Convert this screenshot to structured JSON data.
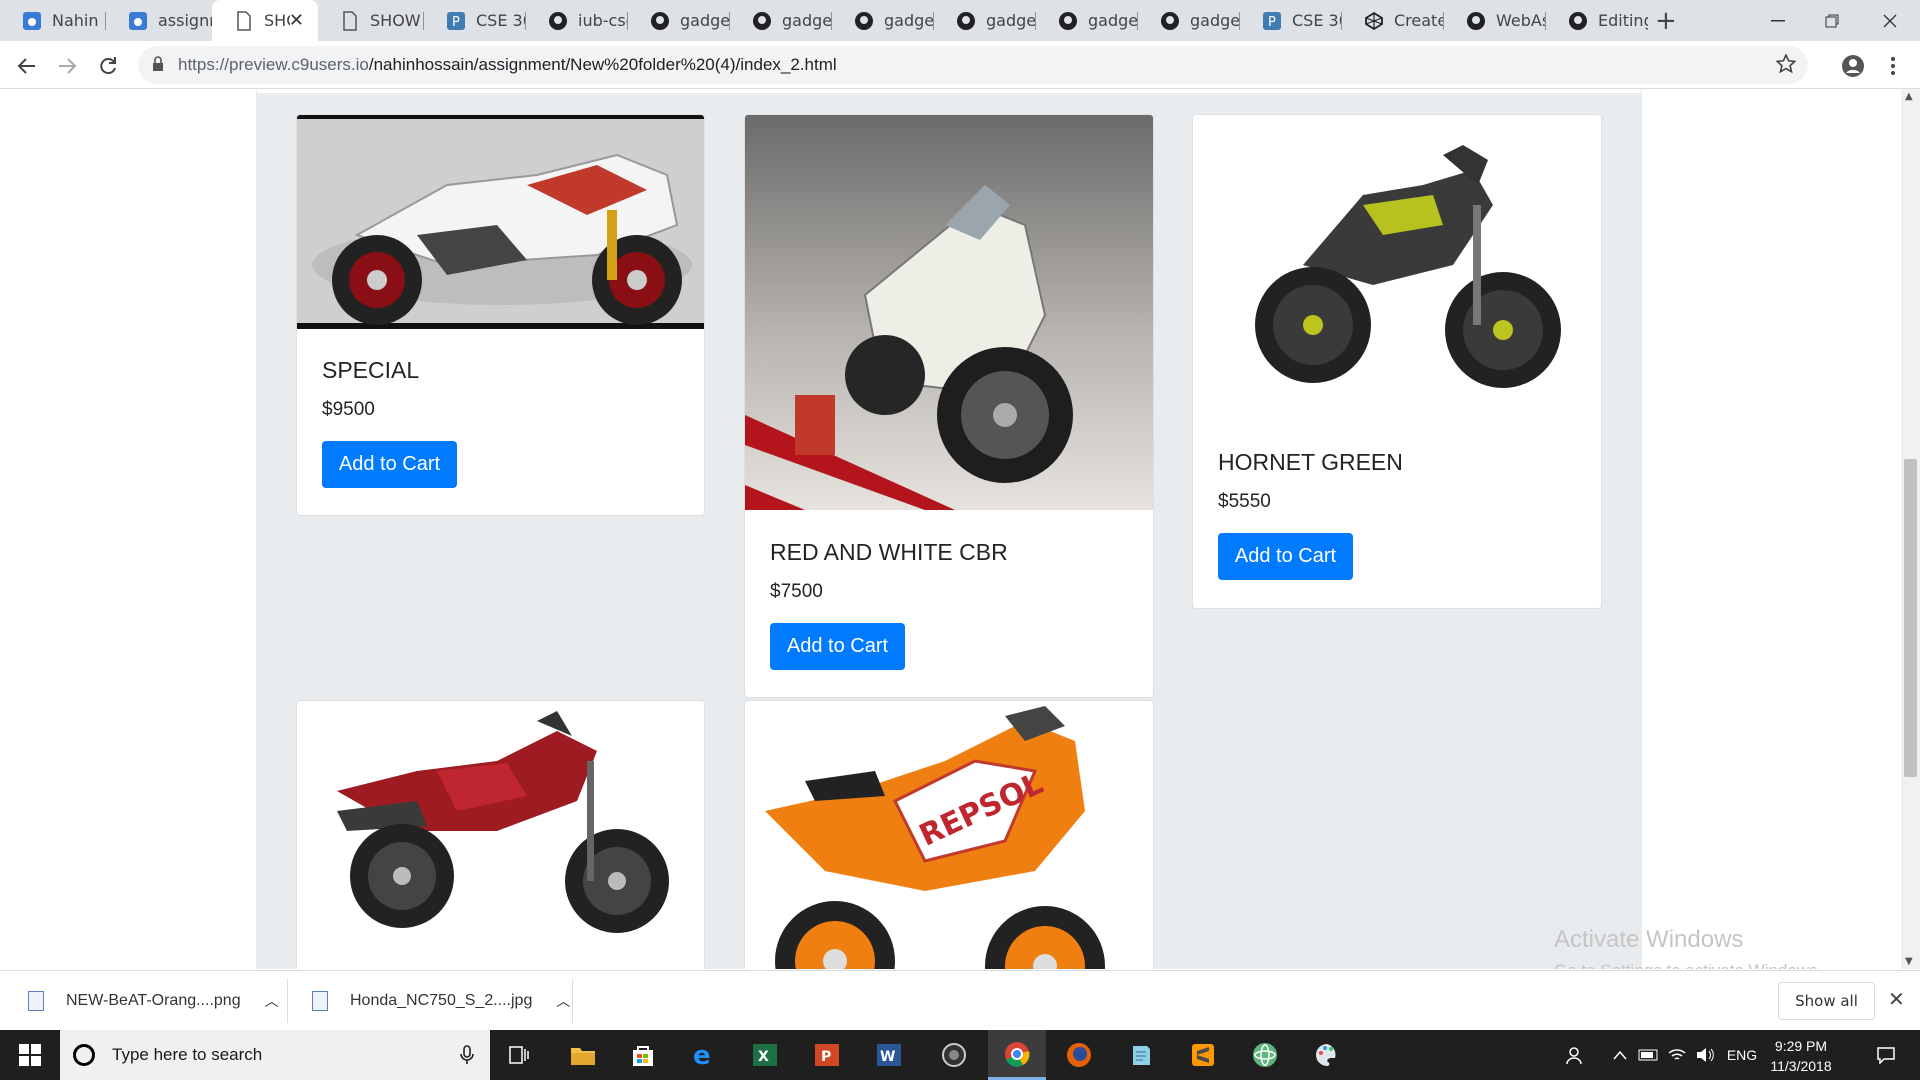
{
  "browser": {
    "tabs": [
      {
        "label": "Nahin H",
        "icon": "cloud9-icon"
      },
      {
        "label": "assignm",
        "icon": "cloud9-icon"
      },
      {
        "label": "SHC",
        "icon": "page-icon",
        "active": true
      },
      {
        "label": "SHOW I",
        "icon": "page-icon"
      },
      {
        "label": "CSE 309",
        "icon": "piazza-icon"
      },
      {
        "label": "iub-cse",
        "icon": "github-icon"
      },
      {
        "label": "gadget",
        "icon": "github-icon"
      },
      {
        "label": "gadget",
        "icon": "github-icon"
      },
      {
        "label": "gadget",
        "icon": "github-icon"
      },
      {
        "label": "gadget",
        "icon": "github-icon"
      },
      {
        "label": "gadget",
        "icon": "github-icon"
      },
      {
        "label": "gadget",
        "icon": "github-icon"
      },
      {
        "label": "CSE 309",
        "icon": "piazza-icon"
      },
      {
        "label": "Create",
        "icon": "codepen-icon"
      },
      {
        "label": "WebAs",
        "icon": "github-icon"
      },
      {
        "label": "Editing",
        "icon": "github-icon"
      }
    ],
    "url_host": "https://preview.c9users.io",
    "url_path": "/nahinhossain/assignment/New%20folder%20(4)/index_2.html"
  },
  "products": [
    {
      "title": "SPECIAL",
      "price": "$9500",
      "button": "Add to Cart",
      "image": "white-honda-sportbike-image"
    },
    {
      "title": "RED AND WHITE CBR",
      "price": "$7500",
      "button": "Add to Cart",
      "image": "white-cbr-showroom-image"
    },
    {
      "title": "HORNET GREEN",
      "price": "$5550",
      "button": "Add to Cart",
      "image": "hornet-green-motorcycle-image"
    },
    {
      "title": "",
      "price": "",
      "button": "",
      "image": "red-xblade-motorcycle-image"
    },
    {
      "title": "",
      "price": "",
      "button": "",
      "image": "repsol-cbr-motorcycle-image"
    }
  ],
  "watermark": {
    "line1": "Activate Windows",
    "line2": "Go to Settings to activate Windows."
  },
  "downloads": {
    "items": [
      "NEW-BeAT-Orang....png",
      "Honda_NC750_S_2....jpg"
    ],
    "show_all": "Show all"
  },
  "taskbar": {
    "search_placeholder": "Type here to search",
    "language": "ENG",
    "time": "9:29 PM",
    "date": "11/3/2018"
  },
  "colors": {
    "accent": "#007bff",
    "page_bg": "#e9ecef",
    "tab_bg": "#dee1e6"
  }
}
